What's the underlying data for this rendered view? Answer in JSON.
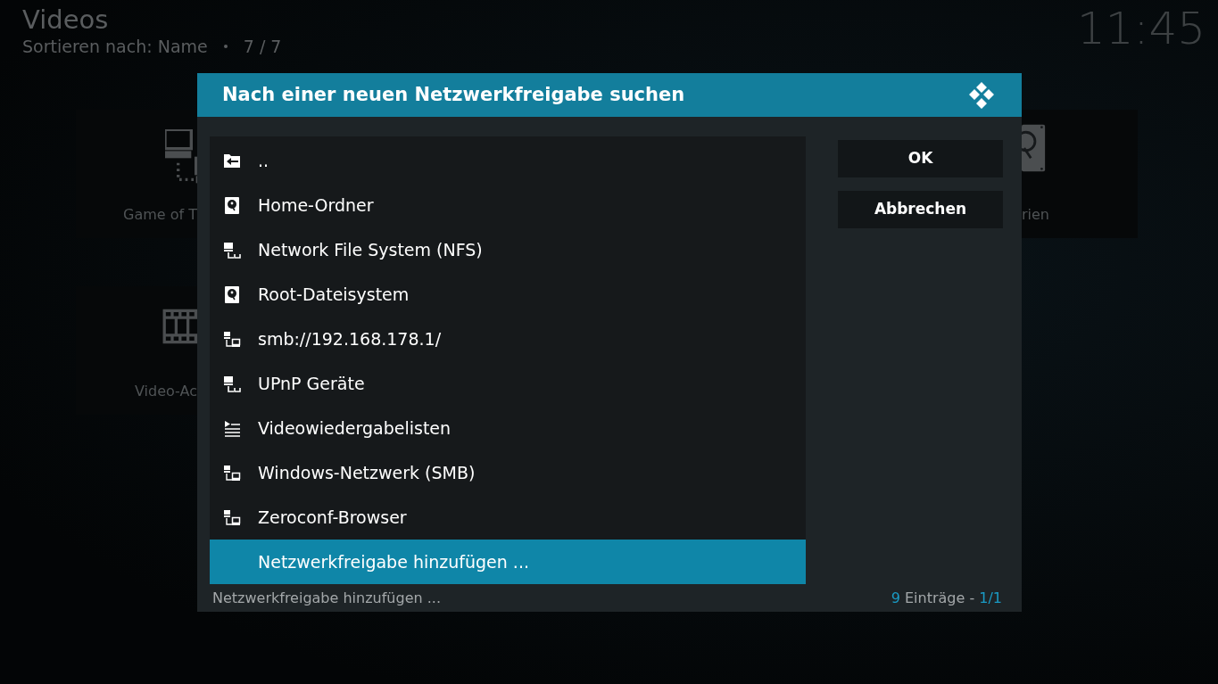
{
  "header": {
    "title": "Videos",
    "sort_label": "Sortieren nach: Name",
    "count": "7 / 7"
  },
  "clock": "11:45",
  "tiles_left": [
    {
      "label": "Game of T",
      "kind": "network"
    },
    {
      "label": "Video-Ac",
      "kind": "film"
    }
  ],
  "tiles_right": [
    {
      "label": "rien",
      "kind": "drive"
    }
  ],
  "dialog": {
    "title": "Nach einer neuen Netzwerkfreigabe suchen",
    "items": [
      {
        "label": "..",
        "kind": "back",
        "selected": false
      },
      {
        "label": "Home-Ordner",
        "kind": "drive",
        "selected": false
      },
      {
        "label": "Network File System (NFS)",
        "kind": "network",
        "selected": false
      },
      {
        "label": "Root-Dateisystem",
        "kind": "drive",
        "selected": false
      },
      {
        "label": "smb://192.168.178.1/",
        "kind": "host",
        "selected": false
      },
      {
        "label": "UPnP Geräte",
        "kind": "network",
        "selected": false
      },
      {
        "label": "Videowiedergabelisten",
        "kind": "playlist",
        "selected": false
      },
      {
        "label": "Windows-Netzwerk (SMB)",
        "kind": "host",
        "selected": false
      },
      {
        "label": "Zeroconf-Browser",
        "kind": "host",
        "selected": false
      },
      {
        "label": "Netzwerkfreigabe hinzufügen ...",
        "kind": "action",
        "selected": true
      }
    ],
    "buttons": [
      "OK",
      "Abbrechen"
    ],
    "footer_label": "Netzwerkfreigabe hinzufügen ...",
    "footer_count": {
      "count": "9",
      "text": "Einträge -",
      "page": "1/1"
    }
  }
}
